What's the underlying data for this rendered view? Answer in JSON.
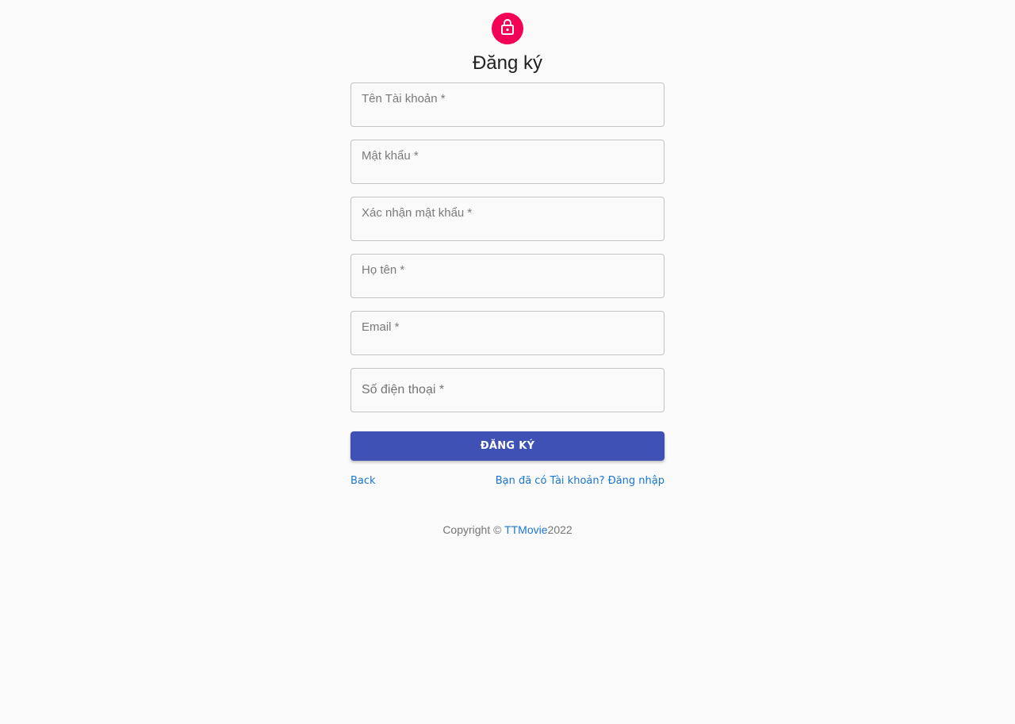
{
  "header": {
    "icon": "lock-icon",
    "title": "Đăng ký",
    "avatar_color": "#f50057"
  },
  "form": {
    "fields": [
      {
        "label": "Tên Tài khoản *",
        "value": ""
      },
      {
        "label": "Mật khẩu *",
        "value": ""
      },
      {
        "label": "Xác nhận mật khẩu *",
        "value": ""
      },
      {
        "label": "Họ tên *",
        "value": ""
      },
      {
        "label": "Email *",
        "value": ""
      },
      {
        "label": "Số điện thoại *",
        "value": ""
      }
    ],
    "submit_label": "ĐĂNG KÝ",
    "submit_color": "#3f51b5"
  },
  "links": {
    "back": "Back",
    "login": "Bạn đã có Tài khoản? Đăng nhập",
    "link_color": "#1976d2"
  },
  "footer": {
    "prefix": "Copyright © ",
    "brand": "TTMovie",
    "year": "2022"
  }
}
